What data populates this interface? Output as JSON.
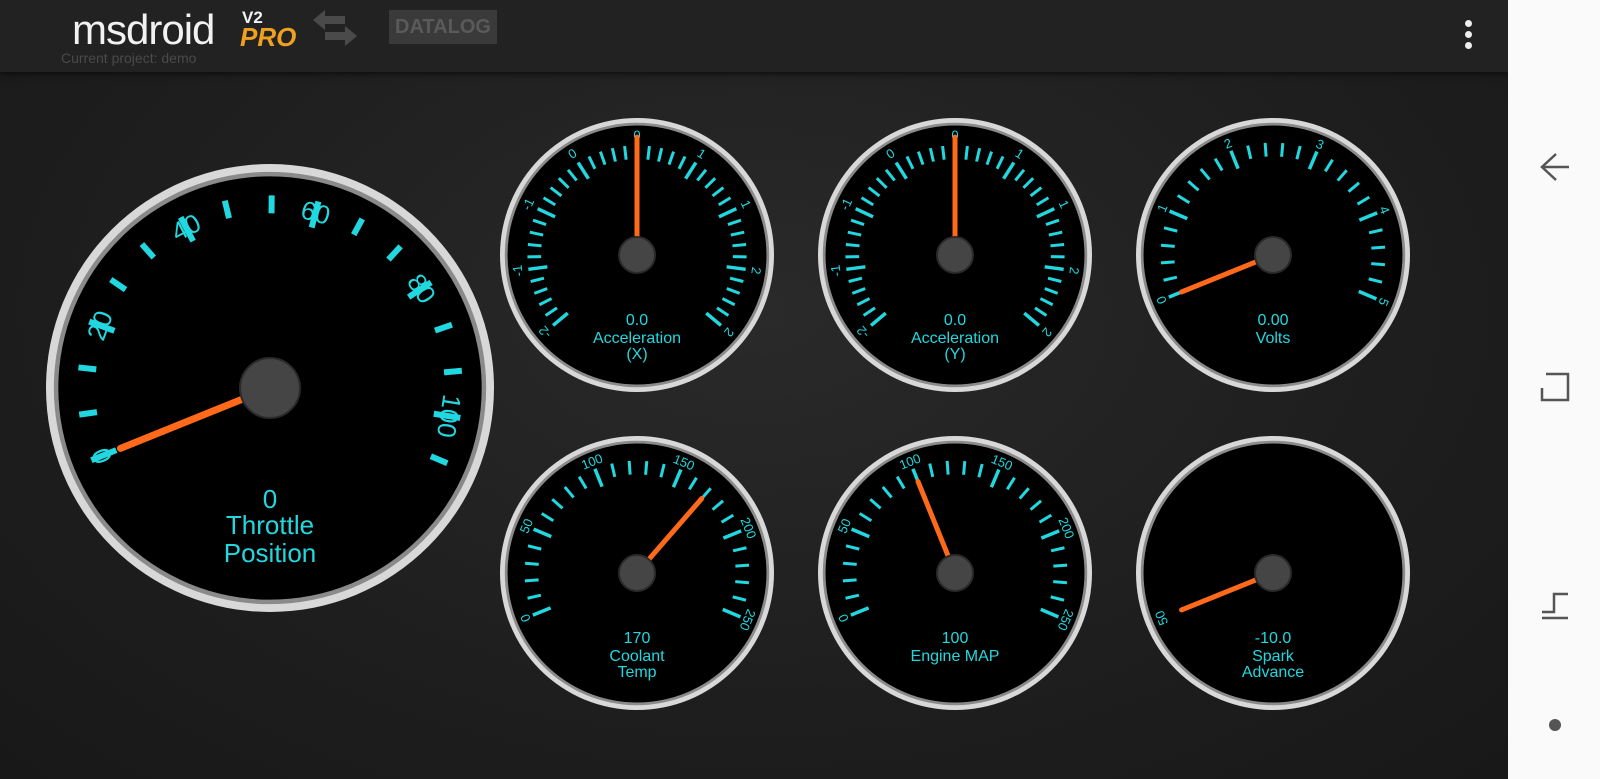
{
  "app": {
    "logo_main": "msdroid",
    "logo_version": "V2",
    "logo_edition": "PRO",
    "project_label": "Current project: demo",
    "datalog_label": "DATALOG",
    "swap_icon": "swap-arrows-icon",
    "menu_icon": "more-vert-icon"
  },
  "navbar": {
    "back_icon": "back-icon",
    "recents_icon": "recents-icon",
    "home_icon": "home-dot-icon"
  },
  "colors": {
    "tick": "#22d8e0",
    "needle": "#ff6a1a",
    "text": "#22d8e0",
    "face": "#000000",
    "bezel": "#c8c8c8",
    "accent": "#f0a020"
  },
  "gauges": [
    {
      "id": "throttle",
      "value_text": "0",
      "label_lines": [
        "Throttle",
        "Position"
      ],
      "labels": [
        "0",
        "20",
        "40",
        "60",
        "80",
        "100"
      ],
      "value": 0
    },
    {
      "id": "accel-x",
      "value_text": "0.0",
      "label_lines": [
        "Acceleration",
        "(X)"
      ],
      "labels": [
        "-2",
        "-1",
        "-1",
        "0",
        "0",
        "1",
        "1",
        "2",
        "2"
      ],
      "value": 0
    },
    {
      "id": "accel-y",
      "value_text": "0.0",
      "label_lines": [
        "Acceleration",
        "(Y)"
      ],
      "labels": [
        "-2",
        "-1",
        "-1",
        "0",
        "0",
        "1",
        "1",
        "2",
        "2"
      ],
      "value": 0
    },
    {
      "id": "volts",
      "value_text": "0.00",
      "label_lines": [
        "Volts"
      ],
      "labels": [
        "0",
        "1",
        "2",
        "3",
        "4",
        "5"
      ],
      "value": 0
    },
    {
      "id": "coolant",
      "value_text": "170",
      "label_lines": [
        "Coolant",
        "Temp"
      ],
      "labels": [
        "0",
        "50",
        "100",
        "150",
        "200",
        "250"
      ],
      "value": 170
    },
    {
      "id": "map",
      "value_text": "100",
      "label_lines": [
        "Engine MAP"
      ],
      "labels": [
        "0",
        "50",
        "100",
        "150",
        "200",
        "250"
      ],
      "value": 100
    },
    {
      "id": "spark",
      "value_text": "-10.0",
      "label_lines": [
        "Spark",
        "Advance"
      ],
      "labels": [
        "50"
      ],
      "value": -10
    }
  ]
}
